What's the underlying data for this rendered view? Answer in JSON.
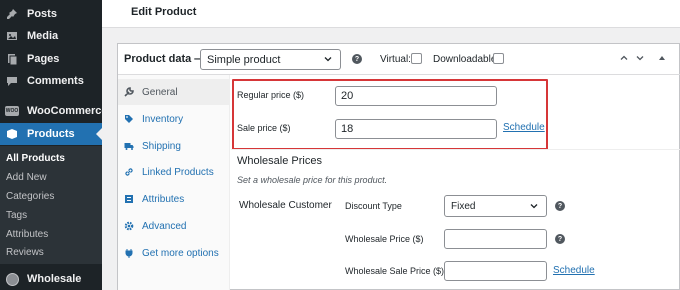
{
  "sidebar": {
    "items": [
      {
        "label": "Posts",
        "icon": "pin-icon"
      },
      {
        "label": "Media",
        "icon": "media-icon"
      },
      {
        "label": "Pages",
        "icon": "pages-icon"
      },
      {
        "label": "Comments",
        "icon": "comments-icon"
      },
      {
        "label": "WooCommerce",
        "icon": "woocommerce-icon",
        "badge": "WOO"
      },
      {
        "label": "Products",
        "icon": "products-icon"
      },
      {
        "label": "Wholesale",
        "icon": "avatar-icon"
      }
    ],
    "submenu": [
      "All Products",
      "Add New",
      "Categories",
      "Tags",
      "Attributes",
      "Reviews"
    ]
  },
  "header": {
    "title": "Edit Product"
  },
  "product_data": {
    "label": "Product data —",
    "type_selected": "Simple product",
    "virtual_label": "Virtual:",
    "downloadable_label": "Downloadable:",
    "virtual_checked": false,
    "downloadable_checked": false
  },
  "tabs": [
    "General",
    "Inventory",
    "Shipping",
    "Linked Products",
    "Attributes",
    "Advanced",
    "Get more options"
  ],
  "pricing": {
    "regular_label": "Regular price ($)",
    "regular_value": "20",
    "sale_label": "Sale price ($)",
    "sale_value": "18",
    "schedule_label": "Schedule"
  },
  "wholesale": {
    "title": "Wholesale Prices",
    "description": "Set a wholesale price for this product.",
    "customer_label": "Wholesale Customer",
    "discount_type_label": "Discount Type",
    "discount_type_value": "Fixed",
    "price_label": "Wholesale Price ($)",
    "price_value": "",
    "sale_price_label": "Wholesale Sale Price ($)",
    "sale_price_value": "",
    "schedule_label": "Schedule"
  },
  "colors": {
    "admin_dark": "#1d2327",
    "accent": "#2271b1",
    "highlight": "#d63638"
  }
}
